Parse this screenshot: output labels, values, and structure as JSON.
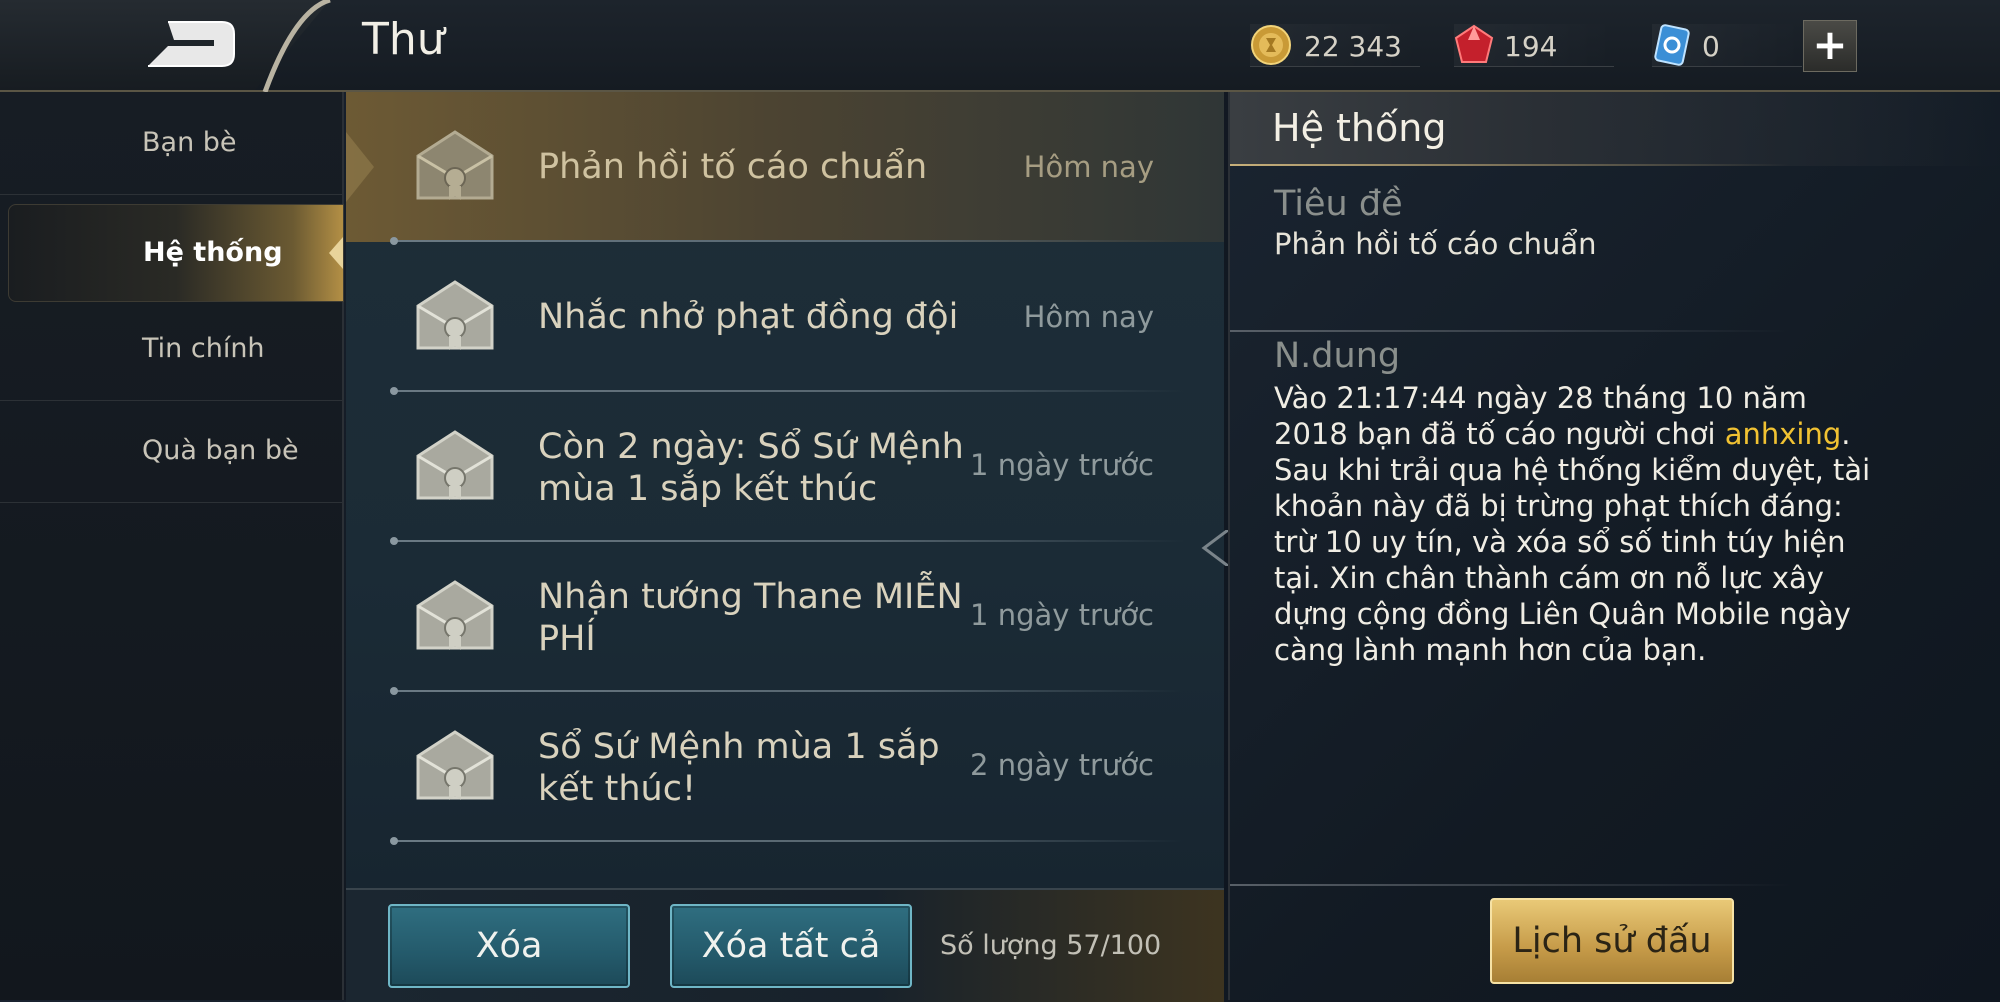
{
  "header": {
    "title": "Thư",
    "currencies": [
      {
        "name": "gold-coin-icon",
        "value": "22 343",
        "color": "#d9b24a"
      },
      {
        "name": "ruby-gem-icon",
        "value": "194",
        "color": "#d8303a"
      },
      {
        "name": "blue-card-icon",
        "value": "0",
        "color": "#5aa8e8"
      }
    ],
    "plus_label": "+"
  },
  "nav": {
    "items": [
      {
        "label": "Bạn bè",
        "active": false
      },
      {
        "label": "Hệ thống",
        "active": true
      },
      {
        "label": "Tin chính",
        "active": false
      },
      {
        "label": "Quà bạn bè",
        "active": false
      }
    ]
  },
  "mails": [
    {
      "title": "Phản hồi tố cáo chuẩn",
      "date": "Hôm nay",
      "selected": true
    },
    {
      "title": "Nhắc nhở phạt đồng đội",
      "date": "Hôm nay",
      "selected": false
    },
    {
      "title": "Còn 2 ngày: Sổ Sứ Mệnh mùa 1 sắp kết thúc",
      "date": "1 ngày trước",
      "selected": false
    },
    {
      "title": "Nhận tướng Thane MIỄN PHÍ",
      "date": "1 ngày trước",
      "selected": false
    },
    {
      "title": "Sổ Sứ Mệnh mùa 1 sắp kết thúc!",
      "date": "2 ngày trước",
      "selected": false
    }
  ],
  "bottom": {
    "delete_label": "Xóa",
    "delete_all_label": "Xóa tất cả",
    "quantity": "Số lượng 57/100"
  },
  "detail": {
    "header": "Hệ thống",
    "subject_label": "Tiêu đề",
    "subject": "Phản hồi tố cáo chuẩn",
    "content_label": "N.dung",
    "content_before": "Vào 21:17:44 ngày 28 tháng 10 năm 2018 bạn đã tố cáo người chơi ",
    "content_highlight": "anhxing",
    "content_after": ". Sau khi trải qua hệ thống kiểm duyệt, tài khoản này đã bị trừng phạt thích đáng: trừ 10 uy tín, và xóa sổ số tinh túy hiện tại. Xin chân thành cám ơn nỗ lực xây dựng cộng đồng Liên Quân Mobile ngày càng lành mạnh hơn của bạn.",
    "highlight_color": "#f1c232",
    "history_button": "Lịch sử đấu"
  }
}
